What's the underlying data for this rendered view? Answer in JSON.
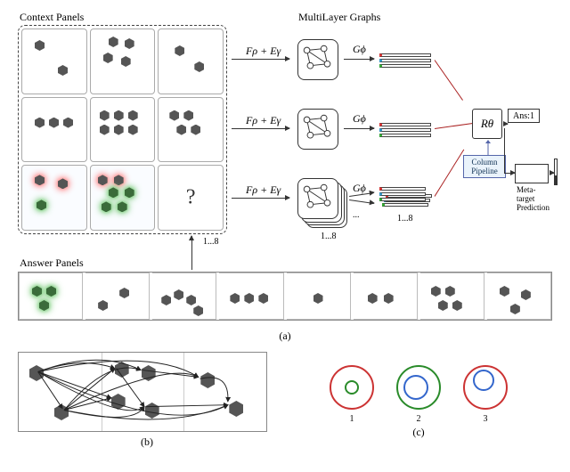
{
  "labels": {
    "context_panels": "Context Panels",
    "multilayer_graphs": "MultiLayer Graphs",
    "answer_panels": "Answer Panels",
    "fe": "Fρ + Eγ",
    "gphi": "Gϕ",
    "rtheta": "Rθ",
    "ans": "Ans:1",
    "column_pipeline": "Column Pipeline",
    "meta": "Meta-\ntarget\nPrediction",
    "range": "1...8",
    "sub_a": "(a)",
    "sub_b": "(b)",
    "sub_c": "(c)"
  },
  "ring_labels": [
    "1",
    "2",
    "3"
  ],
  "rings": [
    {
      "outer": "#c33",
      "inner": "#2a8b2a",
      "inner_off": [
        17,
        17,
        16,
        16
      ]
    },
    {
      "outer": "#2a8b2a",
      "inner": "#36c",
      "inner_off": [
        8,
        11,
        28,
        28
      ]
    },
    {
      "outer": "#c33",
      "inner": "#36c",
      "inner_off": [
        11,
        5,
        24,
        24
      ]
    }
  ]
}
